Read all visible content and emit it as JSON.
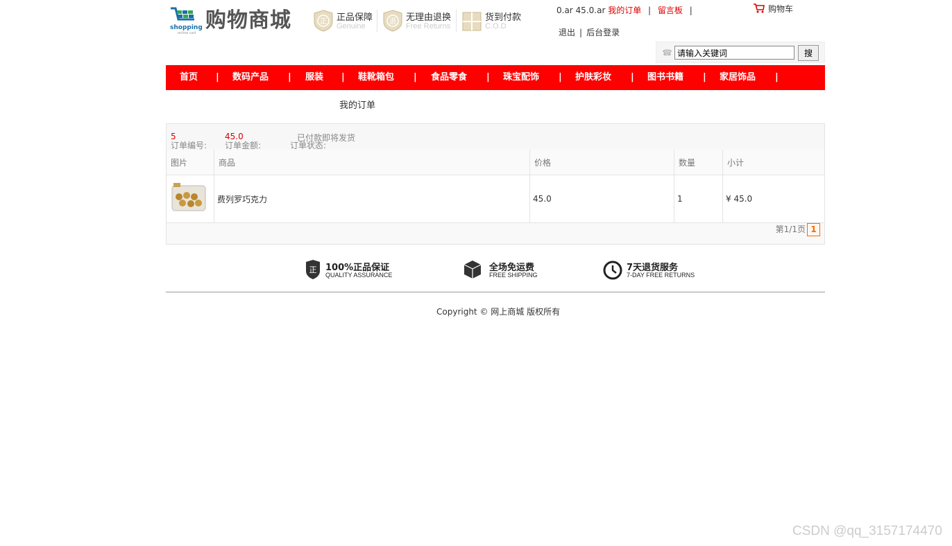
{
  "header": {
    "brand": "购物商城",
    "logo_text": "shopping",
    "logo_sub": "online cart",
    "promos": [
      {
        "title": "正品保障",
        "sub": "Genuine",
        "badge": "正"
      },
      {
        "title": "无理由退换",
        "sub": "Free Returns",
        "badge": "退"
      },
      {
        "title": "货到付款",
        "sub": "C.O.D",
        "badge": "¥"
      }
    ],
    "user_text": "0.ar 45.0.ar",
    "my_orders": "我的订单",
    "message_board": "留言板",
    "cart": "购物车",
    "logout": "退出",
    "admin_login": "后台登录"
  },
  "search": {
    "value": "请输入关键词",
    "button": "搜"
  },
  "nav": {
    "items": [
      "首页",
      "数码产品",
      "服装",
      "鞋靴箱包",
      "食品零食",
      "珠宝配饰",
      "护肤彩妆",
      "图书书籍",
      "家居饰品"
    ]
  },
  "page_title": "我的订单",
  "order": {
    "number_label": "订单编号:",
    "number": "5",
    "amount_label": "订单金额:",
    "amount": "45.0",
    "status_label": "订单状态:",
    "status": "已付款即将发货",
    "columns": [
      "图片",
      "商品",
      "价格",
      "数量",
      "小计"
    ],
    "rows": [
      {
        "name": "费列罗巧克力",
        "price": "45.0",
        "qty": "1",
        "subtotal": "¥ 45.0"
      }
    ],
    "pager_text": "第1/1页",
    "current_page": "1"
  },
  "guarantees": [
    {
      "title": "100%正品保证",
      "sub": "QUALITY ASSURANCE",
      "icon": "shield-icon"
    },
    {
      "title": "全场免运费",
      "sub": "FREE SHIPPING",
      "icon": "box-icon"
    },
    {
      "title": "7天退货服务",
      "sub": "7-DAY FREE RETURNS",
      "icon": "clock-icon"
    }
  ],
  "footer": {
    "copyright": "Copyright © 网上商城 版权所有"
  },
  "watermark": "CSDN @qq_3157174470",
  "colors": {
    "nav_bg": "#ff0000",
    "accent_red": "#dd0000",
    "pager_orange": "#ff6600"
  }
}
